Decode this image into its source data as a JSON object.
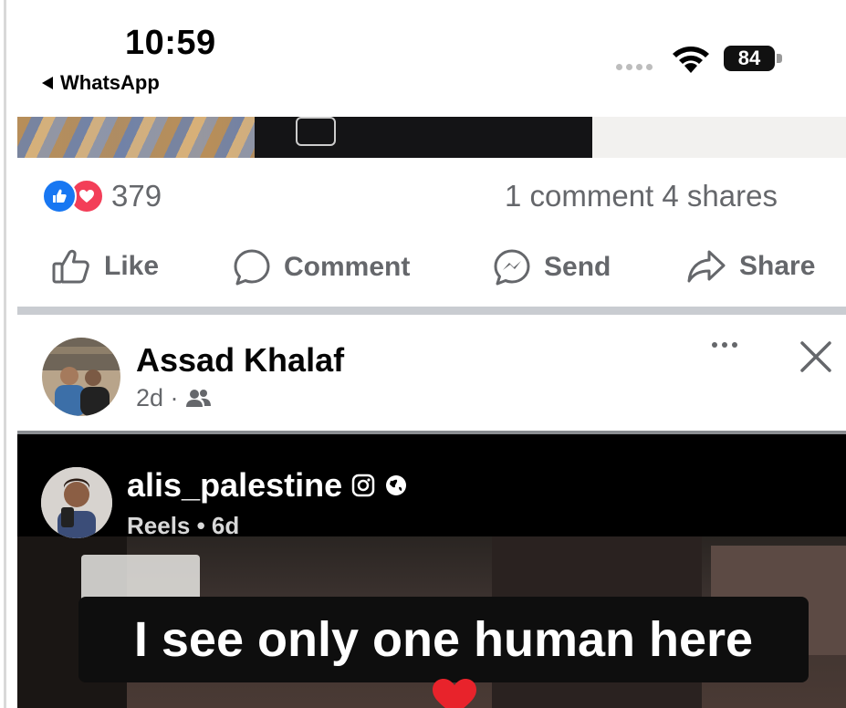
{
  "status_bar": {
    "time": "10:59",
    "back_app": "WhatsApp",
    "battery": "84"
  },
  "post1": {
    "reaction_count": "379",
    "comment_share": "1 comment  4 shares",
    "actions": {
      "like": "Like",
      "comment": "Comment",
      "send": "Send",
      "share": "Share"
    }
  },
  "post2": {
    "author": "Assad Khalaf",
    "time": "2d ·",
    "audience_icon": "friends-icon",
    "reel": {
      "username": "alis_palestine",
      "source": "Reels • 6d",
      "caption": "I see only one human here"
    }
  },
  "colors": {
    "facebook_blue": "#1877f2",
    "love_red": "#f33e58",
    "secondary_text": "#65676b",
    "divider": "#c9ccd1"
  }
}
